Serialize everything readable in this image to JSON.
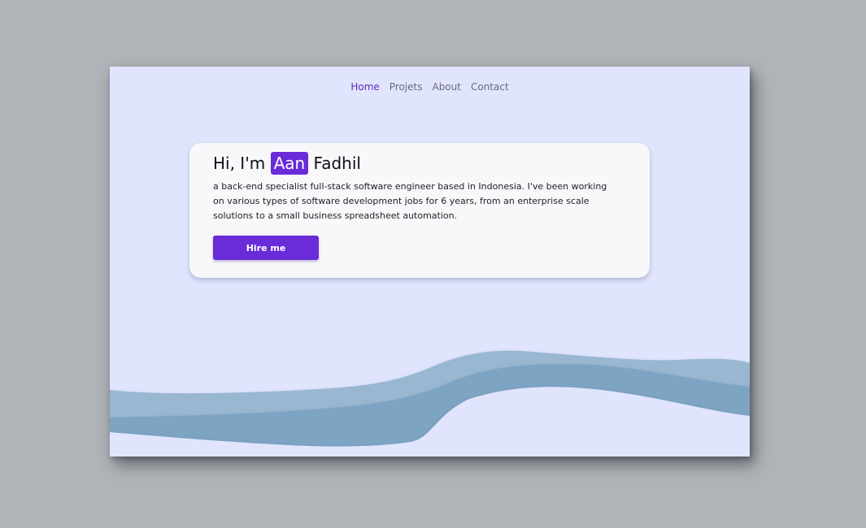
{
  "nav": {
    "items": [
      {
        "label": "Home",
        "active": true
      },
      {
        "label": "Projets",
        "active": false
      },
      {
        "label": "About",
        "active": false
      },
      {
        "label": "Contact",
        "active": false
      }
    ]
  },
  "hero": {
    "greeting": "Hi, I'm",
    "highlight_name": "Aan",
    "last_name": "Fadhil",
    "description": "a back-end specialist full-stack software engineer based in Indonesia. I've been working on various types of software development jobs for 6 years, from an enterprise scale solutions to a small business spreadsheet automation.",
    "cta_label": "Hire me"
  },
  "colors": {
    "background": "#e0e5fd",
    "accent": "#6a2bd9",
    "nav_active": "#5b2bb6",
    "wave_light": "#9ab7d1",
    "wave_dark": "#7ea4c3"
  }
}
